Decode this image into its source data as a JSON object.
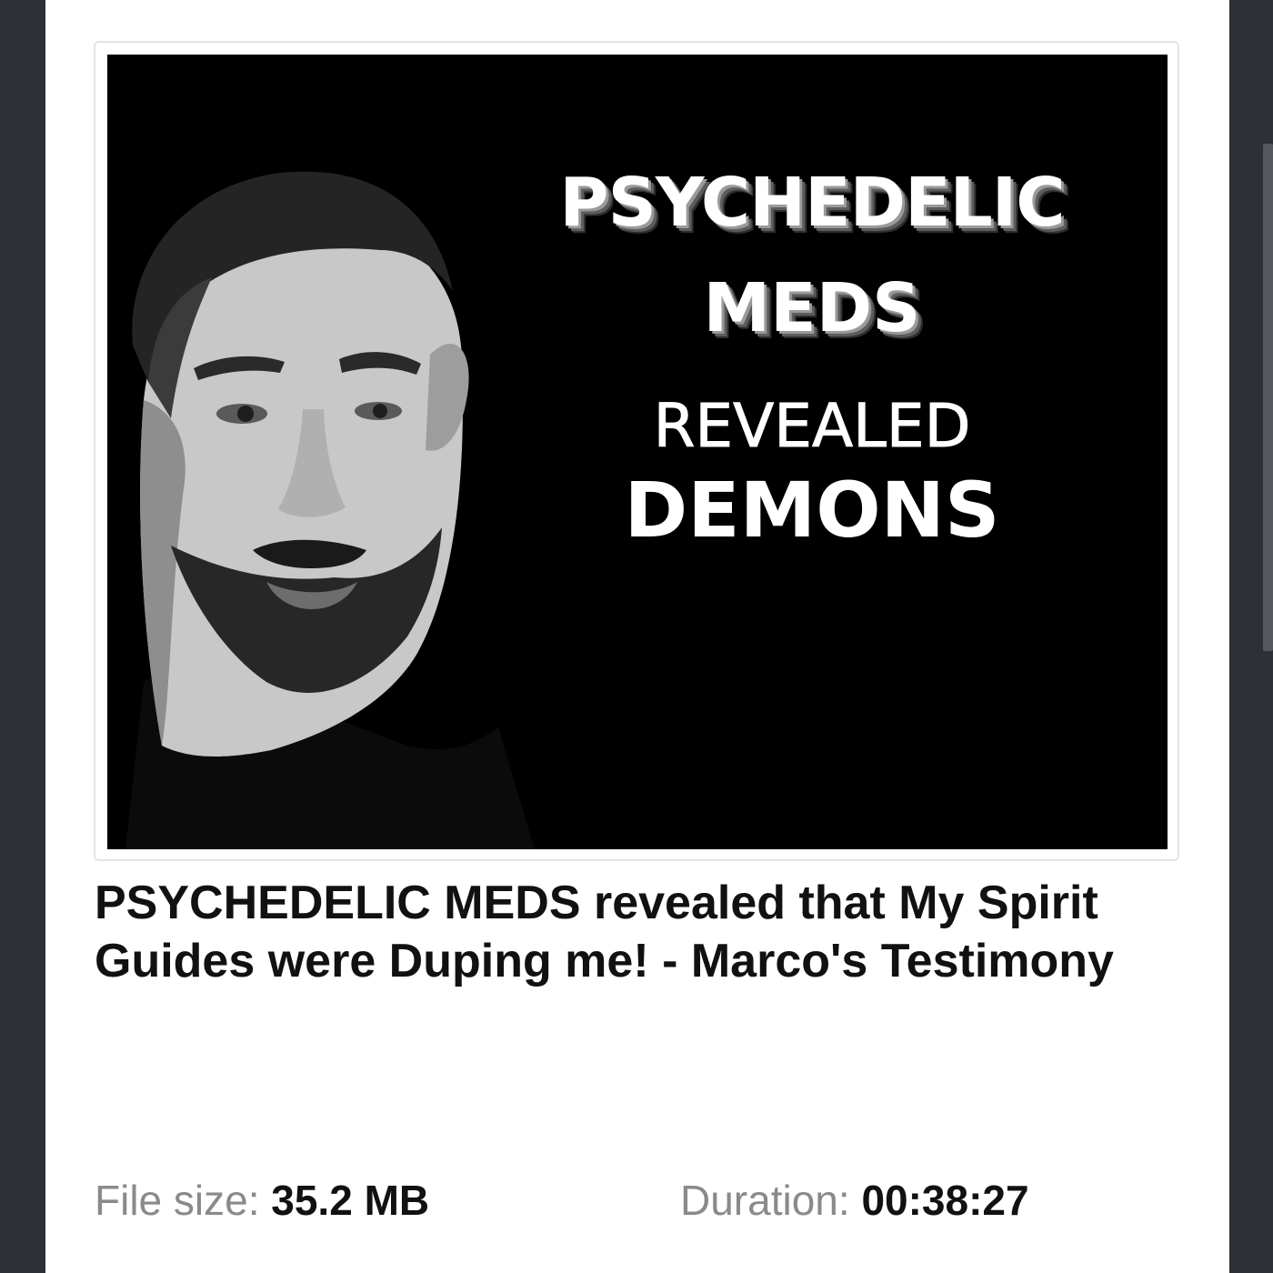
{
  "thumbnail": {
    "lines": [
      "PSYCHEDELIC",
      "MEDS",
      "REVEALED",
      "DEMONS"
    ]
  },
  "episode": {
    "title": "PSYCHEDELIC MEDS revealed that My Spirit Guides were Duping me! - Marco's Testimony"
  },
  "file_info": {
    "size_label": "File size:",
    "size_value": "35.2 MB",
    "duration_label": "Duration:",
    "duration_value": "00:38:27"
  },
  "colors": {
    "background": "#2d3036",
    "panel": "#ffffff",
    "title_text": "#111111",
    "label_text": "#8a8a8a"
  }
}
